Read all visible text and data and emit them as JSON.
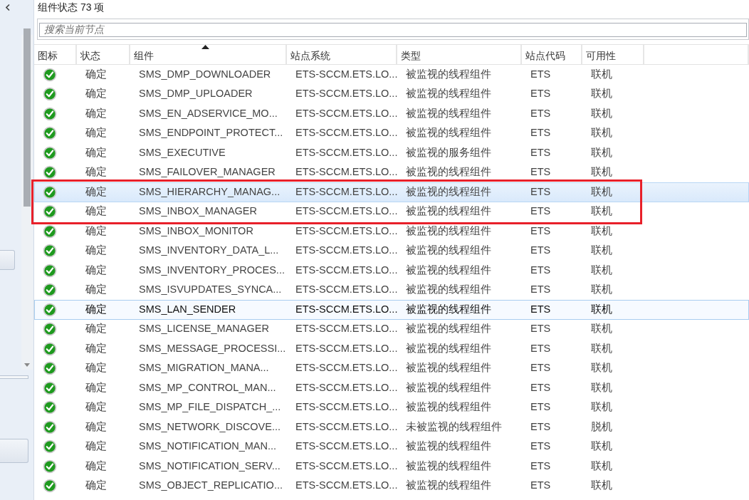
{
  "list_header": {
    "title": "组件状态 73 项"
  },
  "search": {
    "placeholder": "搜索当前节点"
  },
  "table": {
    "columns": [
      {
        "label": "图标",
        "sorted": false
      },
      {
        "label": "状态",
        "sorted": false
      },
      {
        "label": "组件",
        "sorted": true
      },
      {
        "label": "站点系统",
        "sorted": false
      },
      {
        "label": "类型",
        "sorted": false
      },
      {
        "label": "站点代码",
        "sorted": false
      },
      {
        "label": "可用性",
        "sorted": false
      }
    ],
    "rows": [
      {
        "status": "确定",
        "component": "SMS_DMP_DOWNLOADER",
        "site_system": "ETS-SCCM.ETS.LO...",
        "type": "被监视的线程组件",
        "site_code": "ETS",
        "availability": "联机",
        "selected": false,
        "focused": false,
        "annotated": false
      },
      {
        "status": "确定",
        "component": "SMS_DMP_UPLOADER",
        "site_system": "ETS-SCCM.ETS.LO...",
        "type": "被监视的线程组件",
        "site_code": "ETS",
        "availability": "联机",
        "selected": false,
        "focused": false,
        "annotated": false
      },
      {
        "status": "确定",
        "component": "SMS_EN_ADSERVICE_MO...",
        "site_system": "ETS-SCCM.ETS.LO...",
        "type": "被监视的线程组件",
        "site_code": "ETS",
        "availability": "联机",
        "selected": false,
        "focused": false,
        "annotated": false
      },
      {
        "status": "确定",
        "component": "SMS_ENDPOINT_PROTECT...",
        "site_system": "ETS-SCCM.ETS.LO...",
        "type": "被监视的线程组件",
        "site_code": "ETS",
        "availability": "联机",
        "selected": false,
        "focused": false,
        "annotated": false
      },
      {
        "status": "确定",
        "component": "SMS_EXECUTIVE",
        "site_system": "ETS-SCCM.ETS.LO...",
        "type": "被监视的服务组件",
        "site_code": "ETS",
        "availability": "联机",
        "selected": false,
        "focused": false,
        "annotated": false
      },
      {
        "status": "确定",
        "component": "SMS_FAILOVER_MANAGER",
        "site_system": "ETS-SCCM.ETS.LO...",
        "type": "被监视的线程组件",
        "site_code": "ETS",
        "availability": "联机",
        "selected": false,
        "focused": false,
        "annotated": false
      },
      {
        "status": "确定",
        "component": "SMS_HIERARCHY_MANAG...",
        "site_system": "ETS-SCCM.ETS.LO...",
        "type": "被监视的线程组件",
        "site_code": "ETS",
        "availability": "联机",
        "selected": true,
        "focused": false,
        "annotated": true
      },
      {
        "status": "确定",
        "component": "SMS_INBOX_MANAGER",
        "site_system": "ETS-SCCM.ETS.LO...",
        "type": "被监视的线程组件",
        "site_code": "ETS",
        "availability": "联机",
        "selected": false,
        "focused": false,
        "annotated": true
      },
      {
        "status": "确定",
        "component": "SMS_INBOX_MONITOR",
        "site_system": "ETS-SCCM.ETS.LO...",
        "type": "被监视的线程组件",
        "site_code": "ETS",
        "availability": "联机",
        "selected": false,
        "focused": false,
        "annotated": false
      },
      {
        "status": "确定",
        "component": "SMS_INVENTORY_DATA_L...",
        "site_system": "ETS-SCCM.ETS.LO...",
        "type": "被监视的线程组件",
        "site_code": "ETS",
        "availability": "联机",
        "selected": false,
        "focused": false,
        "annotated": false
      },
      {
        "status": "确定",
        "component": "SMS_INVENTORY_PROCES...",
        "site_system": "ETS-SCCM.ETS.LO...",
        "type": "被监视的线程组件",
        "site_code": "ETS",
        "availability": "联机",
        "selected": false,
        "focused": false,
        "annotated": false
      },
      {
        "status": "确定",
        "component": "SMS_ISVUPDATES_SYNCA...",
        "site_system": "ETS-SCCM.ETS.LO...",
        "type": "被监视的线程组件",
        "site_code": "ETS",
        "availability": "联机",
        "selected": false,
        "focused": false,
        "annotated": false
      },
      {
        "status": "确定",
        "component": "SMS_LAN_SENDER",
        "site_system": "ETS-SCCM.ETS.LO...",
        "type": "被监视的线程组件",
        "site_code": "ETS",
        "availability": "联机",
        "selected": false,
        "focused": true,
        "annotated": false
      },
      {
        "status": "确定",
        "component": "SMS_LICENSE_MANAGER",
        "site_system": "ETS-SCCM.ETS.LO...",
        "type": "被监视的线程组件",
        "site_code": "ETS",
        "availability": "联机",
        "selected": false,
        "focused": false,
        "annotated": false
      },
      {
        "status": "确定",
        "component": "SMS_MESSAGE_PROCESSI...",
        "site_system": "ETS-SCCM.ETS.LO...",
        "type": "被监视的线程组件",
        "site_code": "ETS",
        "availability": "联机",
        "selected": false,
        "focused": false,
        "annotated": false
      },
      {
        "status": "确定",
        "component": "SMS_MIGRATION_MANA...",
        "site_system": "ETS-SCCM.ETS.LO...",
        "type": "被监视的线程组件",
        "site_code": "ETS",
        "availability": "联机",
        "selected": false,
        "focused": false,
        "annotated": false
      },
      {
        "status": "确定",
        "component": "SMS_MP_CONTROL_MAN...",
        "site_system": "ETS-SCCM.ETS.LO...",
        "type": "被监视的线程组件",
        "site_code": "ETS",
        "availability": "联机",
        "selected": false,
        "focused": false,
        "annotated": false
      },
      {
        "status": "确定",
        "component": "SMS_MP_FILE_DISPATCH_...",
        "site_system": "ETS-SCCM.ETS.LO...",
        "type": "被监视的线程组件",
        "site_code": "ETS",
        "availability": "联机",
        "selected": false,
        "focused": false,
        "annotated": false
      },
      {
        "status": "确定",
        "component": "SMS_NETWORK_DISCOVE...",
        "site_system": "ETS-SCCM.ETS.LO...",
        "type": "未被监视的线程组件",
        "site_code": "ETS",
        "availability": "脱机",
        "selected": false,
        "focused": false,
        "annotated": false
      },
      {
        "status": "确定",
        "component": "SMS_NOTIFICATION_MAN...",
        "site_system": "ETS-SCCM.ETS.LO...",
        "type": "被监视的线程组件",
        "site_code": "ETS",
        "availability": "联机",
        "selected": false,
        "focused": false,
        "annotated": false
      },
      {
        "status": "确定",
        "component": "SMS_NOTIFICATION_SERV...",
        "site_system": "ETS-SCCM.ETS.LO...",
        "type": "被监视的线程组件",
        "site_code": "ETS",
        "availability": "联机",
        "selected": false,
        "focused": false,
        "annotated": false
      },
      {
        "status": "确定",
        "component": "SMS_OBJECT_REPLICATIO...",
        "site_system": "ETS-SCCM.ETS.LO...",
        "type": "被监视的线程组件",
        "site_code": "ETS",
        "availability": "联机",
        "selected": false,
        "focused": false,
        "annotated": false
      }
    ]
  }
}
